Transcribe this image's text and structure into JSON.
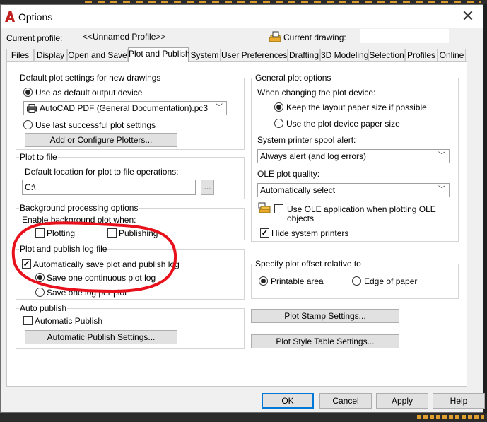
{
  "window": {
    "title": "Options",
    "close_glyph": "✕"
  },
  "profile": {
    "current_profile_label": "Current profile:",
    "current_profile_value": "<<Unnamed Profile>>",
    "current_drawing_label": "Current drawing:",
    "current_drawing_value": ""
  },
  "tabs": [
    "Files",
    "Display",
    "Open and Save",
    "Plot and Publish",
    "System",
    "User Preferences",
    "Drafting",
    "3D Modeling",
    "Selection",
    "Profiles",
    "Online"
  ],
  "active_tab": "Plot and Publish",
  "default_plot": {
    "title": "Default plot settings for new drawings",
    "use_default_label": "Use as default output device",
    "use_default_selected": true,
    "device_value": "AutoCAD PDF (General Documentation).pc3",
    "use_last_label": "Use last successful plot settings",
    "use_last_selected": false,
    "add_plotters_label": "Add or Configure Plotters..."
  },
  "plot_to_file": {
    "title": "Plot to file",
    "label": "Default location for plot to file operations:",
    "value": "C:\\",
    "browse_label": "..."
  },
  "background": {
    "title": "Background processing options",
    "enable_label": "Enable background plot when:",
    "plotting_label": "Plotting",
    "plotting_checked": false,
    "publishing_label": "Publishing",
    "publishing_checked": false
  },
  "log": {
    "title": "Plot and publish log file",
    "auto_save_label": "Automatically save plot and publish log",
    "auto_save_checked": true,
    "continuous_label": "Save one continuous plot log",
    "continuous_selected": true,
    "per_plot_label": "Save one log per plot",
    "per_plot_selected": false
  },
  "auto_publish": {
    "title": "Auto publish",
    "checkbox_label": "Automatic Publish",
    "checked": false,
    "settings_label": "Automatic Publish Settings..."
  },
  "general": {
    "title": "General plot options",
    "changing_label": "When changing the plot device:",
    "keep_layout_label": "Keep the layout paper size if possible",
    "keep_layout_selected": true,
    "use_device_label": "Use the plot device paper size",
    "use_device_selected": false,
    "spool_label": "System printer spool alert:",
    "spool_value": "Always alert (and log errors)",
    "ole_quality_label": "OLE plot quality:",
    "ole_quality_value": "Automatically select",
    "use_ole_label_1": "Use OLE application when plotting OLE",
    "use_ole_label_2": "objects",
    "use_ole_checked": false,
    "hide_printers_label": "Hide system printers",
    "hide_printers_checked": true
  },
  "offset": {
    "title": "Specify plot offset relative to",
    "printable_label": "Printable area",
    "printable_selected": true,
    "edge_label": "Edge of paper",
    "edge_selected": false
  },
  "right_buttons": {
    "stamp_label": "Plot Stamp Settings...",
    "style_label": "Plot Style Table Settings..."
  },
  "footer": {
    "ok_label": "OK",
    "cancel_label": "Cancel",
    "apply_label": "Apply",
    "help_label": "Help"
  },
  "colors": {
    "accent": "#0078d7",
    "annotation": "#e8101a",
    "app_icon": "#c0201e"
  },
  "icons": {
    "app": "autocad-logo-icon",
    "drawing": "drawing-file-icon",
    "printer": "printer-icon",
    "ole": "ole-object-icon",
    "close": "close-icon"
  }
}
